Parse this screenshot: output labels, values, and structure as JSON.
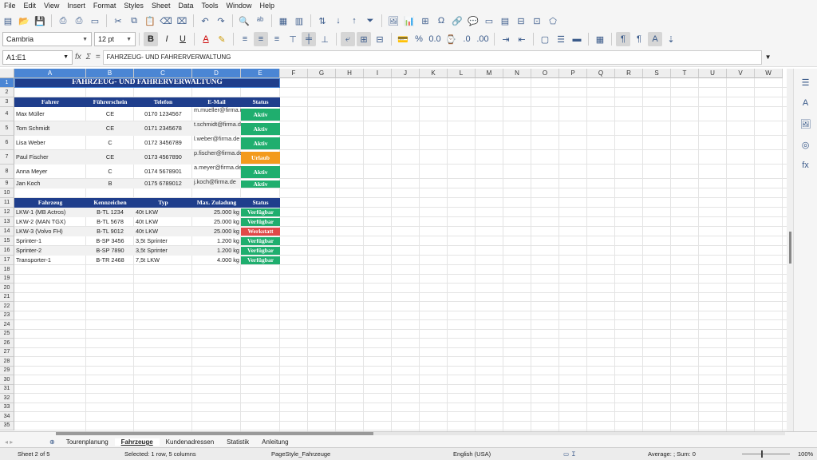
{
  "menu": [
    "File",
    "Edit",
    "View",
    "Insert",
    "Format",
    "Styles",
    "Sheet",
    "Data",
    "Tools",
    "Window",
    "Help"
  ],
  "toolbar": {
    "font_name": "Cambria",
    "font_size": "12 pt"
  },
  "formula_bar": {
    "cell_ref": "A1:E1",
    "content": "FAHRZEUG- UND FAHRERVERWALTUNG"
  },
  "columns": [
    "A",
    "B",
    "C",
    "D",
    "E",
    "F",
    "G",
    "H",
    "I",
    "J",
    "K",
    "L",
    "M",
    "N",
    "O",
    "P",
    "Q",
    "R",
    "S",
    "T",
    "U",
    "V",
    "W"
  ],
  "rows": [
    "1",
    "2",
    "3",
    "4",
    "5",
    "6",
    "7",
    "8",
    "9",
    "10",
    "11",
    "12",
    "13",
    "14",
    "15",
    "16",
    "17",
    "18",
    "19",
    "20",
    "21",
    "22",
    "23",
    "24",
    "25",
    "26",
    "27",
    "28",
    "29",
    "30",
    "31",
    "32",
    "33",
    "34",
    "35"
  ],
  "sheet": {
    "title": "FAHRZEUG- UND FAHRERVERWALTUNG",
    "driver_headers": [
      "Fahrer",
      "Führerschein",
      "Telefon",
      "E-Mail",
      "Status"
    ],
    "drivers": [
      {
        "name": "Max Müller",
        "license": "CE",
        "phone": "0170 1234567",
        "email": "m.mueller@firma.de",
        "status": "Aktiv"
      },
      {
        "name": "Tom Schmidt",
        "license": "CE",
        "phone": "0171 2345678",
        "email": "t.schmidt@firma.de",
        "status": "Aktiv"
      },
      {
        "name": "Lisa Weber",
        "license": "C",
        "phone": "0172 3456789",
        "email": "l.weber@firma.de",
        "status": "Aktiv"
      },
      {
        "name": "Paul Fischer",
        "license": "CE",
        "phone": "0173 4567890",
        "email": "p.fischer@firma.de",
        "status": "Urlaub"
      },
      {
        "name": "Anna Meyer",
        "license": "C",
        "phone": "0174 5678901",
        "email": "a.meyer@firma.de",
        "status": "Aktiv"
      },
      {
        "name": "Jan Koch",
        "license": "B",
        "phone": "0175 6789012",
        "email": "j.koch@firma.de",
        "status": "Aktiv"
      }
    ],
    "vehicle_headers": [
      "Fahrzeug",
      "Kennzeichen",
      "Typ",
      "Max. Zuladung",
      "Status"
    ],
    "vehicles": [
      {
        "name": "LKW-1 (MB Actros)",
        "plate": "B-TL 1234",
        "type": "40t LKW",
        "load": "25.000 kg",
        "status": "Verfügbar"
      },
      {
        "name": "LKW-2 (MAN TGX)",
        "plate": "B-TL 5678",
        "type": "40t LKW",
        "load": "25.000 kg",
        "status": "Verfügbar"
      },
      {
        "name": "LKW-3 (Volvo FH)",
        "plate": "B-TL 9012",
        "type": "40t LKW",
        "load": "25.000 kg",
        "status": "Werkstatt"
      },
      {
        "name": "Sprinter-1",
        "plate": "B-SP 3456",
        "type": "3,5t Sprinter",
        "load": "1.200 kg",
        "status": "Verfügbar"
      },
      {
        "name": "Sprinter-2",
        "plate": "B-SP 7890",
        "type": "3,5t Sprinter",
        "load": "1.200 kg",
        "status": "Verfügbar"
      },
      {
        "name": "Transporter-1",
        "plate": "B-TR 2468",
        "type": "7,5t LKW",
        "load": "4.000 kg",
        "status": "Verfügbar"
      }
    ]
  },
  "status_colors": {
    "Aktiv": "#1fae6e",
    "Urlaub": "#f39a1c",
    "Verfügbar": "#1fae6e",
    "Werkstatt": "#e04848"
  },
  "header_color": "#1f3e8c",
  "tabs": [
    "Tourenplanung",
    "Fahrzeuge",
    "Kundenadressen",
    "Statistik",
    "Anleitung"
  ],
  "active_tab": "Fahrzeuge",
  "statusbar": {
    "sheet": "Sheet 2 of 5",
    "selection": "Selected: 1 row, 5 columns",
    "page_style": "PageStyle_Fahrzeuge",
    "language": "English (USA)",
    "sum": "Average: ; Sum: 0",
    "zoom": "100%"
  }
}
